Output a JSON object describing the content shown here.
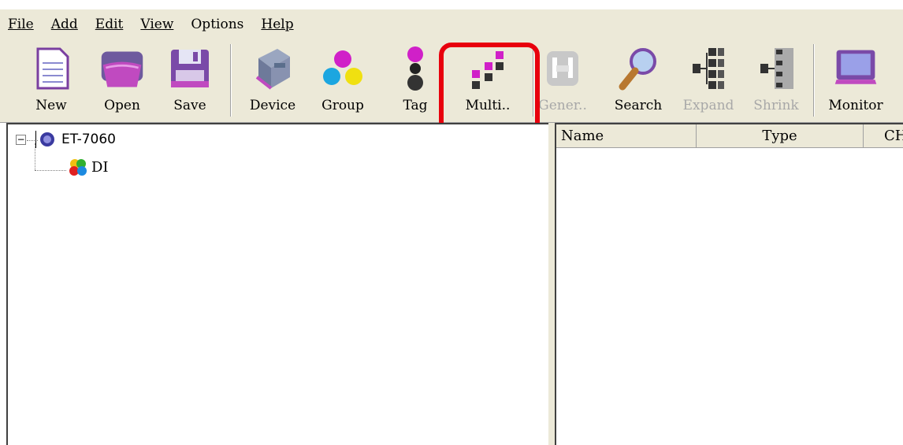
{
  "menu": {
    "file": "File",
    "add": "Add",
    "edit": "Edit",
    "view": "View",
    "options": "Options",
    "help": "Help"
  },
  "toolbar": {
    "new": "New",
    "open": "Open",
    "save": "Save",
    "device": "Device",
    "group": "Group",
    "tag": "Tag",
    "multi": "Multi..",
    "generate": "Gener..",
    "search": "Search",
    "expand": "Expand",
    "shrink": "Shrink",
    "monitor": "Monitor"
  },
  "tree": {
    "root": "ET-7060",
    "child": "DI",
    "root_expander": "−"
  },
  "list": {
    "columns": [
      "Name",
      "Type",
      "CH"
    ]
  },
  "colors": {
    "highlight": "#e8000d",
    "toolbar_bg": "#ece9d8"
  }
}
